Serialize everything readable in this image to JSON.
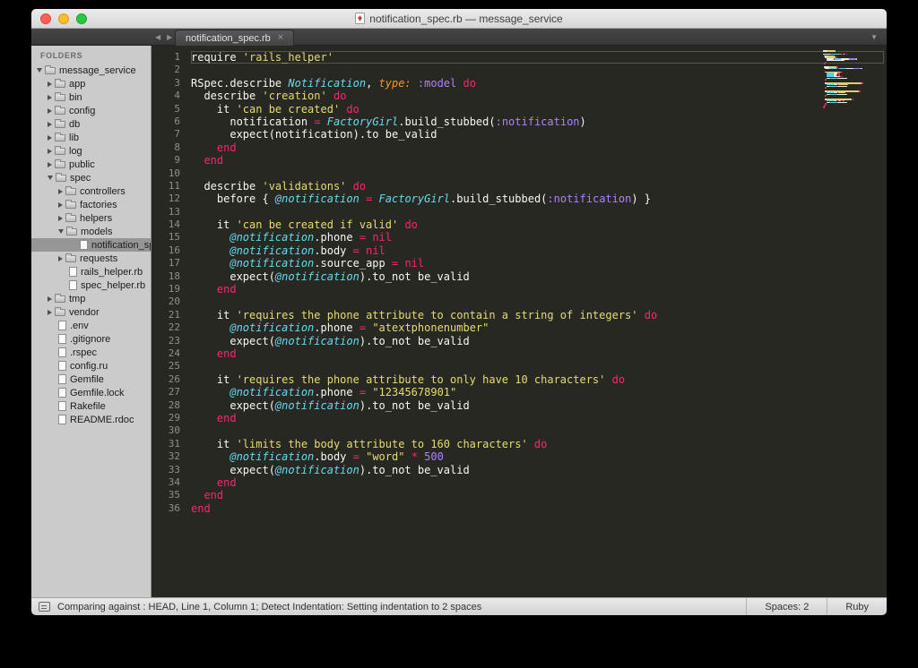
{
  "window": {
    "title": "notification_spec.rb — message_service"
  },
  "tabbar": {
    "back_icon": "◀",
    "forward_icon": "▶",
    "overflow_icon": "▼",
    "tabs": [
      {
        "label": "notification_spec.rb",
        "close_icon": "×",
        "active": true
      }
    ]
  },
  "sidebar": {
    "header": "FOLDERS",
    "items": [
      {
        "label": "message_service",
        "depth": 0,
        "kind": "folder",
        "state": "open"
      },
      {
        "label": "app",
        "depth": 1,
        "kind": "folder",
        "state": "closed"
      },
      {
        "label": "bin",
        "depth": 1,
        "kind": "folder",
        "state": "closed"
      },
      {
        "label": "config",
        "depth": 1,
        "kind": "folder",
        "state": "closed"
      },
      {
        "label": "db",
        "depth": 1,
        "kind": "folder",
        "state": "closed"
      },
      {
        "label": "lib",
        "depth": 1,
        "kind": "folder",
        "state": "closed"
      },
      {
        "label": "log",
        "depth": 1,
        "kind": "folder",
        "state": "closed"
      },
      {
        "label": "public",
        "depth": 1,
        "kind": "folder",
        "state": "closed"
      },
      {
        "label": "spec",
        "depth": 1,
        "kind": "folder",
        "state": "open"
      },
      {
        "label": "controllers",
        "depth": 2,
        "kind": "folder",
        "state": "closed"
      },
      {
        "label": "factories",
        "depth": 2,
        "kind": "folder",
        "state": "closed"
      },
      {
        "label": "helpers",
        "depth": 2,
        "kind": "folder",
        "state": "closed"
      },
      {
        "label": "models",
        "depth": 2,
        "kind": "folder",
        "state": "open"
      },
      {
        "label": "notification_spec.rb",
        "depth": 3,
        "kind": "file",
        "selected": true
      },
      {
        "label": "requests",
        "depth": 2,
        "kind": "folder",
        "state": "closed"
      },
      {
        "label": "rails_helper.rb",
        "depth": 2,
        "kind": "file"
      },
      {
        "label": "spec_helper.rb",
        "depth": 2,
        "kind": "file"
      },
      {
        "label": "tmp",
        "depth": 1,
        "kind": "folder",
        "state": "closed"
      },
      {
        "label": "vendor",
        "depth": 1,
        "kind": "folder",
        "state": "closed"
      },
      {
        "label": ".env",
        "depth": 1,
        "kind": "file"
      },
      {
        "label": ".gitignore",
        "depth": 1,
        "kind": "file"
      },
      {
        "label": ".rspec",
        "depth": 1,
        "kind": "file"
      },
      {
        "label": "config.ru",
        "depth": 1,
        "kind": "file"
      },
      {
        "label": "Gemfile",
        "depth": 1,
        "kind": "file"
      },
      {
        "label": "Gemfile.lock",
        "depth": 1,
        "kind": "file"
      },
      {
        "label": "Rakefile",
        "depth": 1,
        "kind": "file"
      },
      {
        "label": "README.rdoc",
        "depth": 1,
        "kind": "file"
      }
    ]
  },
  "colors": {
    "w": "#F8F8F2",
    "y": "#E6DB74",
    "r": "#F92672",
    "b": "#66D9EF",
    "v": "#66D9EF",
    "o": "#FD971F",
    "p": "#AE81FF",
    "background": "#272822",
    "gutter": "#8F908A"
  },
  "editor": {
    "cursor_line": 1,
    "lines": [
      {
        "n": 1,
        "t": [
          [
            "require ",
            "w"
          ],
          [
            "'rails_helper'",
            "y"
          ]
        ]
      },
      {
        "n": 2,
        "t": []
      },
      {
        "n": 3,
        "t": [
          [
            "RSpec.describe ",
            "w"
          ],
          [
            "Notification",
            "b"
          ],
          [
            ", ",
            "w"
          ],
          [
            "type:",
            "o"
          ],
          [
            " ",
            "w"
          ],
          [
            ":model",
            "p"
          ],
          [
            " ",
            "w"
          ],
          [
            "do",
            "r"
          ]
        ]
      },
      {
        "n": 4,
        "t": [
          [
            "  describe ",
            "w"
          ],
          [
            "'creation'",
            "y"
          ],
          [
            " ",
            "w"
          ],
          [
            "do",
            "r"
          ]
        ]
      },
      {
        "n": 5,
        "t": [
          [
            "    it ",
            "w"
          ],
          [
            "'can be created'",
            "y"
          ],
          [
            " ",
            "w"
          ],
          [
            "do",
            "r"
          ]
        ]
      },
      {
        "n": 6,
        "t": [
          [
            "      notification ",
            "w"
          ],
          [
            "=",
            "r"
          ],
          [
            " ",
            "w"
          ],
          [
            "FactoryGirl",
            "b"
          ],
          [
            ".build_stubbed(",
            "w"
          ],
          [
            ":notification",
            "p"
          ],
          [
            ")",
            "w"
          ]
        ]
      },
      {
        "n": 7,
        "t": [
          [
            "      expect(notification).to be_valid",
            "w"
          ]
        ]
      },
      {
        "n": 8,
        "t": [
          [
            "    ",
            "w"
          ],
          [
            "end",
            "r"
          ]
        ]
      },
      {
        "n": 9,
        "t": [
          [
            "  ",
            "w"
          ],
          [
            "end",
            "r"
          ]
        ]
      },
      {
        "n": 10,
        "t": []
      },
      {
        "n": 11,
        "t": [
          [
            "  describe ",
            "w"
          ],
          [
            "'validations'",
            "y"
          ],
          [
            " ",
            "w"
          ],
          [
            "do",
            "r"
          ]
        ]
      },
      {
        "n": 12,
        "t": [
          [
            "    before { ",
            "w"
          ],
          [
            "@notification",
            "v"
          ],
          [
            " ",
            "w"
          ],
          [
            "=",
            "r"
          ],
          [
            " ",
            "w"
          ],
          [
            "FactoryGirl",
            "b"
          ],
          [
            ".build_stubbed(",
            "w"
          ],
          [
            ":notification",
            "p"
          ],
          [
            ") }",
            "w"
          ]
        ]
      },
      {
        "n": 13,
        "t": []
      },
      {
        "n": 14,
        "t": [
          [
            "    it ",
            "w"
          ],
          [
            "'can be created if valid'",
            "y"
          ],
          [
            " ",
            "w"
          ],
          [
            "do",
            "r"
          ]
        ]
      },
      {
        "n": 15,
        "t": [
          [
            "      ",
            "w"
          ],
          [
            "@notification",
            "v"
          ],
          [
            ".phone ",
            "w"
          ],
          [
            "=",
            "r"
          ],
          [
            " ",
            "w"
          ],
          [
            "nil",
            "r"
          ]
        ]
      },
      {
        "n": 16,
        "t": [
          [
            "      ",
            "w"
          ],
          [
            "@notification",
            "v"
          ],
          [
            ".body ",
            "w"
          ],
          [
            "=",
            "r"
          ],
          [
            " ",
            "w"
          ],
          [
            "nil",
            "r"
          ]
        ]
      },
      {
        "n": 17,
        "t": [
          [
            "      ",
            "w"
          ],
          [
            "@notification",
            "v"
          ],
          [
            ".source_app ",
            "w"
          ],
          [
            "=",
            "r"
          ],
          [
            " ",
            "w"
          ],
          [
            "nil",
            "r"
          ]
        ]
      },
      {
        "n": 18,
        "t": [
          [
            "      expect(",
            "w"
          ],
          [
            "@notification",
            "v"
          ],
          [
            ").to_not be_valid",
            "w"
          ]
        ]
      },
      {
        "n": 19,
        "t": [
          [
            "    ",
            "w"
          ],
          [
            "end",
            "r"
          ]
        ]
      },
      {
        "n": 20,
        "t": []
      },
      {
        "n": 21,
        "t": [
          [
            "    it ",
            "w"
          ],
          [
            "'requires the phone attribute to contain a string of integers'",
            "y"
          ],
          [
            " ",
            "w"
          ],
          [
            "do",
            "r"
          ]
        ]
      },
      {
        "n": 22,
        "t": [
          [
            "      ",
            "w"
          ],
          [
            "@notification",
            "v"
          ],
          [
            ".phone ",
            "w"
          ],
          [
            "=",
            "r"
          ],
          [
            " ",
            "w"
          ],
          [
            "\"atextphonenumber\"",
            "y"
          ]
        ]
      },
      {
        "n": 23,
        "t": [
          [
            "      expect(",
            "w"
          ],
          [
            "@notification",
            "v"
          ],
          [
            ").to_not be_valid",
            "w"
          ]
        ]
      },
      {
        "n": 24,
        "t": [
          [
            "    ",
            "w"
          ],
          [
            "end",
            "r"
          ]
        ]
      },
      {
        "n": 25,
        "t": []
      },
      {
        "n": 26,
        "t": [
          [
            "    it ",
            "w"
          ],
          [
            "'requires the phone attribute to only have 10 characters'",
            "y"
          ],
          [
            " ",
            "w"
          ],
          [
            "do",
            "r"
          ]
        ]
      },
      {
        "n": 27,
        "t": [
          [
            "      ",
            "w"
          ],
          [
            "@notification",
            "v"
          ],
          [
            ".phone ",
            "w"
          ],
          [
            "=",
            "r"
          ],
          [
            " ",
            "w"
          ],
          [
            "\"12345678901\"",
            "y"
          ]
        ]
      },
      {
        "n": 28,
        "t": [
          [
            "      expect(",
            "w"
          ],
          [
            "@notification",
            "v"
          ],
          [
            ").to_not be_valid",
            "w"
          ]
        ]
      },
      {
        "n": 29,
        "t": [
          [
            "    ",
            "w"
          ],
          [
            "end",
            "r"
          ]
        ]
      },
      {
        "n": 30,
        "t": []
      },
      {
        "n": 31,
        "t": [
          [
            "    it ",
            "w"
          ],
          [
            "'limits the body attribute to 160 characters'",
            "y"
          ],
          [
            " ",
            "w"
          ],
          [
            "do",
            "r"
          ]
        ]
      },
      {
        "n": 32,
        "t": [
          [
            "      ",
            "w"
          ],
          [
            "@notification",
            "v"
          ],
          [
            ".body ",
            "w"
          ],
          [
            "=",
            "r"
          ],
          [
            " ",
            "w"
          ],
          [
            "\"word\"",
            "y"
          ],
          [
            " ",
            "w"
          ],
          [
            "*",
            "r"
          ],
          [
            " ",
            "w"
          ],
          [
            "500",
            "p"
          ]
        ]
      },
      {
        "n": 33,
        "t": [
          [
            "      expect(",
            "w"
          ],
          [
            "@notification",
            "v"
          ],
          [
            ").to_not be_valid",
            "w"
          ]
        ]
      },
      {
        "n": 34,
        "t": [
          [
            "    ",
            "w"
          ],
          [
            "end",
            "r"
          ]
        ]
      },
      {
        "n": 35,
        "t": [
          [
            "  ",
            "w"
          ],
          [
            "end",
            "r"
          ]
        ]
      },
      {
        "n": 36,
        "t": [
          [
            "end",
            "r"
          ]
        ]
      }
    ]
  },
  "statusbar": {
    "message": "Comparing against : HEAD, Line 1, Column 1; Detect Indentation: Setting indentation to 2 spaces",
    "spaces": "Spaces: 2",
    "syntax": "Ruby"
  }
}
